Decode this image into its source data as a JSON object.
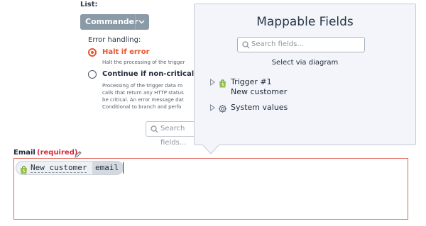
{
  "form": {
    "list_label": "List:",
    "list_value": "Commander AJ",
    "error_handling_title": "Error handling:",
    "options": [
      {
        "label": "Halt if error",
        "selected": true,
        "description_lines": [
          "Halt the processing of the trigger"
        ]
      },
      {
        "label": "Continue if non-critical error",
        "selected": false,
        "description_lines": [
          "Processing of the trigger data ro",
          "calls that return any HTTP status",
          "be critical. An error message dat",
          "Conditional to branch and perfo"
        ]
      }
    ],
    "search_placeholder": "Search fields..."
  },
  "email": {
    "label": "Email",
    "required_text": "(required)",
    "token": {
      "source": "New customer",
      "field": "email"
    }
  },
  "popover": {
    "title": "Mappable Fields",
    "search_placeholder": "Search fields...",
    "select_via_diagram": "Select via diagram",
    "tree": [
      {
        "icon": "shopify-bag-icon",
        "title": "Trigger #1",
        "subtitle": "New customer",
        "expanded": false
      },
      {
        "icon": "gear-icon",
        "title": "System values",
        "expanded": false
      }
    ]
  },
  "colors": {
    "accent_orange": "#e8552c",
    "required_red": "#d6283a",
    "select_gray": "#8a9aa6",
    "shopify_green": "#95bf47",
    "popover_bg": "#f3f5fa"
  }
}
